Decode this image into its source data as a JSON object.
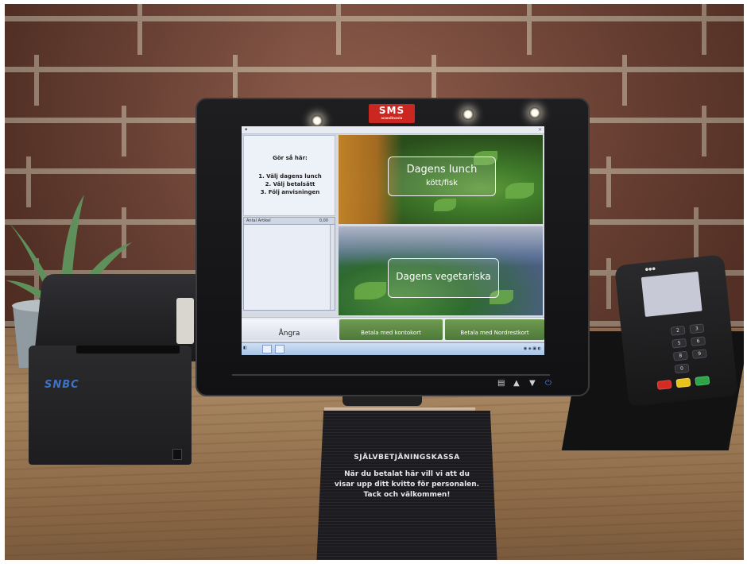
{
  "monitor": {
    "brand_badge": "SMS",
    "brand_badge_sub": "scandinavia"
  },
  "pos_screen": {
    "instructions": {
      "heading": "Gör så här:",
      "steps": [
        "1. Välj dagens lunch",
        "2. Välj betalsätt",
        "3. Följ anvisningen"
      ]
    },
    "article_list": {
      "columns": [
        "Antal",
        "Artikel"
      ],
      "total": "0,00"
    },
    "tiles": [
      {
        "title": "Dagens lunch",
        "subtitle": "kött/fisk"
      },
      {
        "title": "Dagens vegetariska"
      }
    ],
    "buttons": {
      "undo": "Ångra",
      "pay_account_card": "Betala med kontokort",
      "pay_nordrest_card": "Betala med Nordrestkort"
    }
  },
  "printer": {
    "logo": "SNBC"
  },
  "sign": {
    "title": "SJÄLVBETJÄNINGSKASSA",
    "body_lines": [
      "När du betalat här vill vi att du",
      "visar upp ditt kvitto för personalen.",
      "Tack och välkommen!"
    ]
  },
  "colors": {
    "brick": "#7b4636",
    "mortar": "#b79c88",
    "desk": "#a5845f",
    "screen_green_button": "#4d7a38",
    "brand_red": "#c9271f"
  }
}
